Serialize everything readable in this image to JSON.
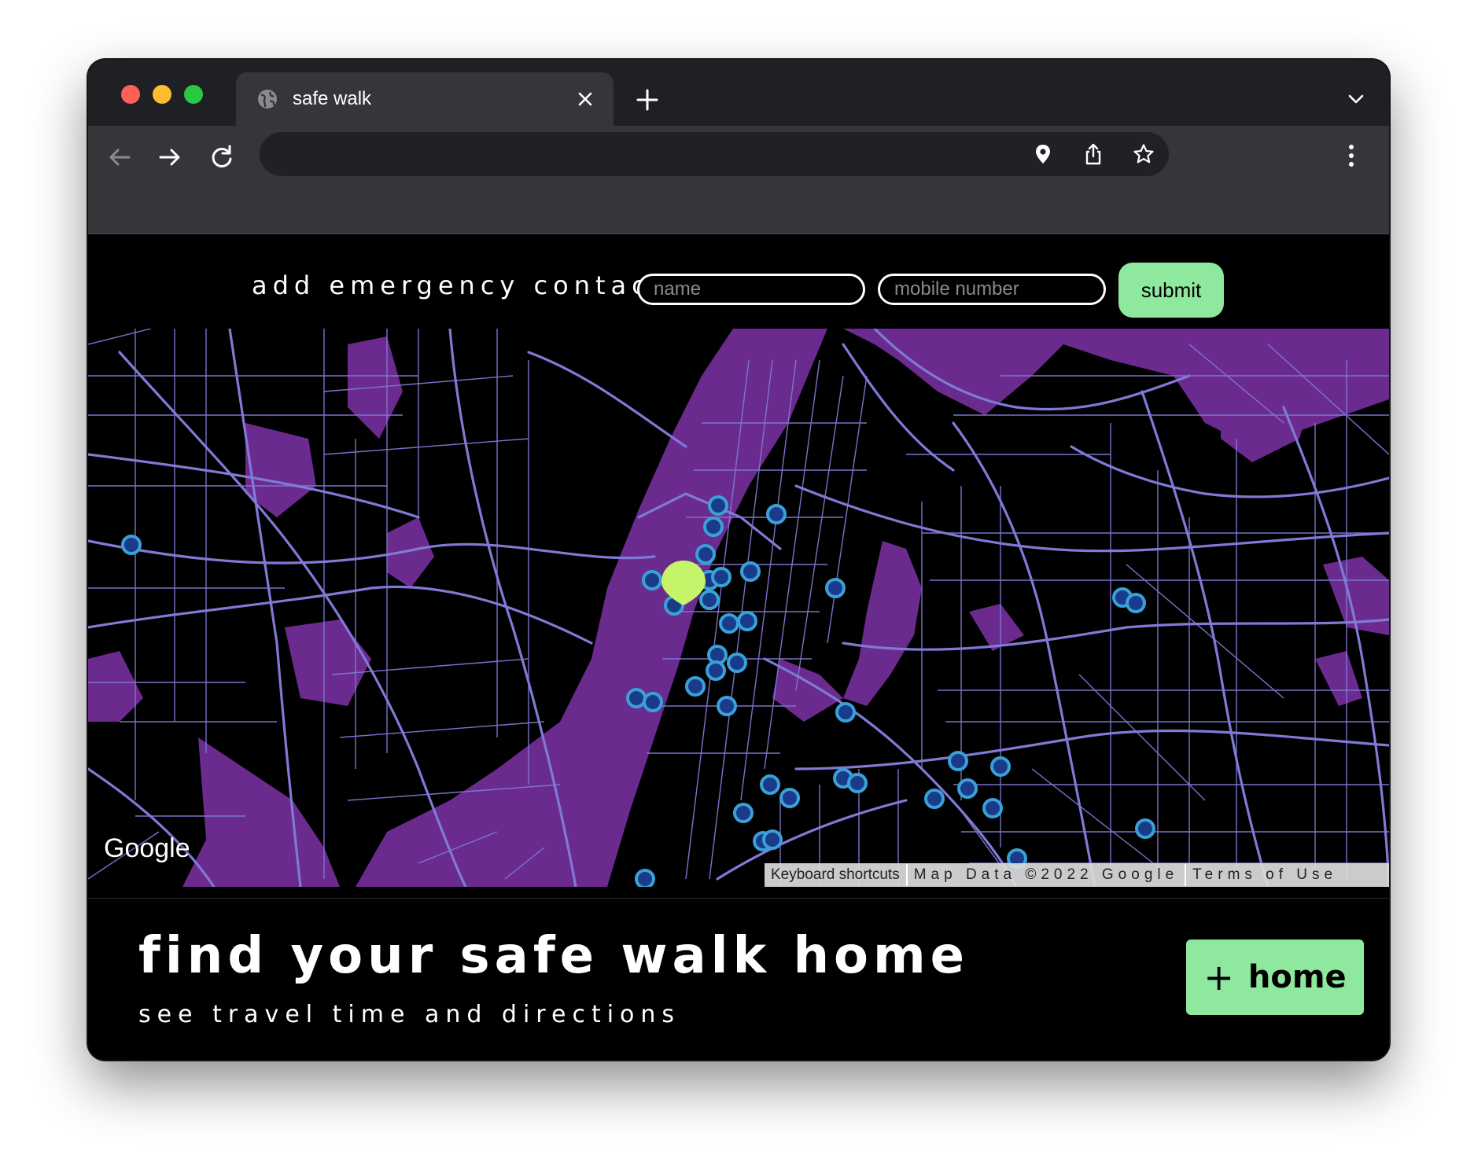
{
  "browser": {
    "tab_title": "safe walk",
    "tab_icon": "globe-icon",
    "window_controls": [
      "close",
      "minimize",
      "zoom"
    ]
  },
  "contact_form": {
    "label": "add emergency contact",
    "name_placeholder": "name",
    "mobile_placeholder": "mobile number",
    "submit_label": "submit"
  },
  "map": {
    "logo": "Google",
    "keyboard_shortcuts": "Keyboard shortcuts",
    "map_data": "Map Data ©2022 Google",
    "terms": "Terms of Use",
    "colors": {
      "water": "#6b2a8e",
      "roads": "#7f7ad6",
      "land": "#000000",
      "marker": "#c5f46a",
      "hotspot": "#3aa0d8"
    }
  },
  "footer": {
    "headline": "find your safe walk home",
    "subline": "see travel time and directions",
    "home_button_label": "home",
    "home_button_icon": "plus-icon"
  },
  "colors": {
    "accent": "#8ee89d",
    "background": "#000000",
    "text": "#ffffff"
  }
}
